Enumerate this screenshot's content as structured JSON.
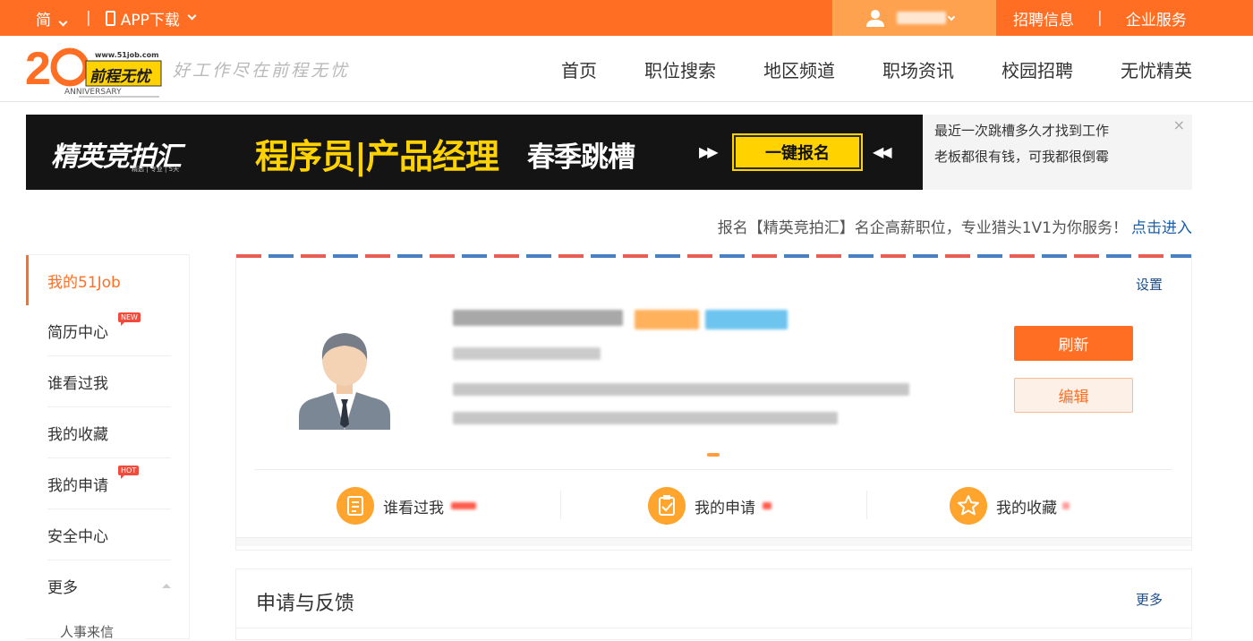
{
  "topbar": {
    "lang_label": "简",
    "app_label": "APP下载",
    "recruit_label": "招聘信息",
    "enterprise_label": "企业服务",
    "colors": {
      "bar": "#ff6e22",
      "user_box": "#ffa24f"
    }
  },
  "header": {
    "logo_url_text": "www.51job.com",
    "logo_brand": "前程无忧",
    "logo_anniversary": "ANNIVERSARY",
    "slogan": "好工作尽在前程无忧",
    "nav": [
      "首页",
      "职位搜索",
      "地区频道",
      "职场资讯",
      "校园招聘",
      "无忧精英"
    ]
  },
  "banner": {
    "brand": "精英竞拍汇",
    "brand_sub": "精选 | 专业 | 5天",
    "headline": "程序员|产品经理",
    "subline": "春季跳槽",
    "arrow_left": "▶▶",
    "arrow_right": "◀◀",
    "cta": "一键报名",
    "side_line1": "最近一次跳槽多久才找到工作",
    "side_line2": "老板都很有钱，可我都很倒霉",
    "close_icon": "×"
  },
  "promo": {
    "text": "报名【精英竞拍汇】名企高薪职位，专业猎头1V1为你服务！",
    "link": "点击进入"
  },
  "sidebar": {
    "title": "我的51Job",
    "items": [
      {
        "label": "简历中心",
        "tag": "NEW"
      },
      {
        "label": "谁看过我"
      },
      {
        "label": "我的收藏"
      },
      {
        "label": "我的申请",
        "tag": "HOT"
      },
      {
        "label": "安全中心"
      },
      {
        "label": "更多"
      }
    ],
    "sub_item": "人事来信"
  },
  "profile": {
    "settings_label": "设置",
    "refresh_label": "刷新",
    "edit_label": "编辑",
    "stats": [
      {
        "label": "谁看过我",
        "icon": "resume-icon"
      },
      {
        "label": "我的申请",
        "icon": "clipboard-check-icon"
      },
      {
        "label": "我的收藏",
        "icon": "star-icon"
      }
    ]
  },
  "section": {
    "title": "申请与反馈",
    "more": "更多"
  }
}
